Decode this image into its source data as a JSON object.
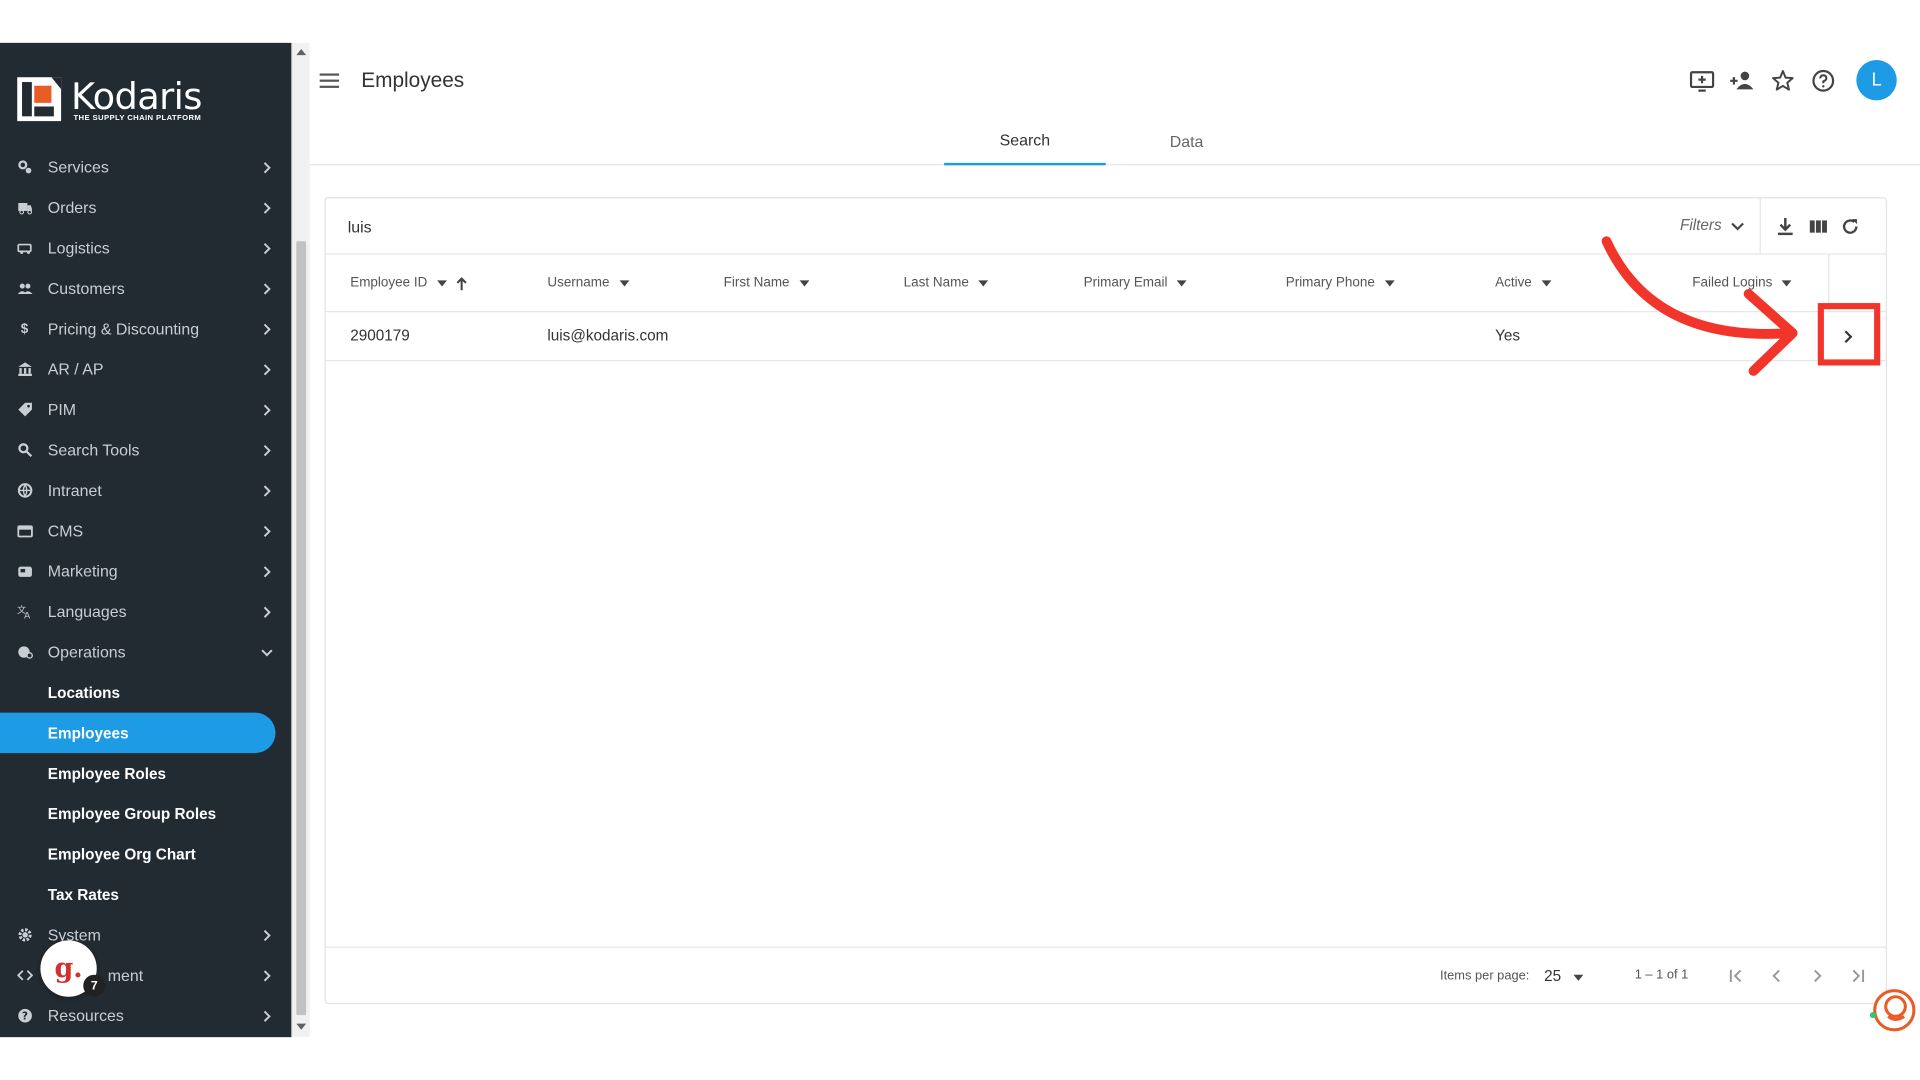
{
  "brand": {
    "name": "Kodaris",
    "tagline": "THE SUPPLY CHAIN PLATFORM"
  },
  "sidebar": {
    "items": [
      {
        "label": "Services",
        "icon": "services-icon"
      },
      {
        "label": "Orders",
        "icon": "truck-icon"
      },
      {
        "label": "Logistics",
        "icon": "logistics-icon"
      },
      {
        "label": "Customers",
        "icon": "people-icon"
      },
      {
        "label": "Pricing & Discounting",
        "icon": "dollar-icon"
      },
      {
        "label": "AR / AP",
        "icon": "bank-icon"
      },
      {
        "label": "PIM",
        "icon": "tag-icon"
      },
      {
        "label": "Search Tools",
        "icon": "search-icon"
      },
      {
        "label": "Intranet",
        "icon": "intranet-icon"
      },
      {
        "label": "CMS",
        "icon": "cms-icon"
      },
      {
        "label": "Marketing",
        "icon": "marketing-icon"
      },
      {
        "label": "Languages",
        "icon": "translate-icon"
      },
      {
        "label": "Operations",
        "icon": "operations-icon",
        "expanded": true
      }
    ],
    "operations_children": [
      {
        "label": "Locations"
      },
      {
        "label": "Employees",
        "active": true
      },
      {
        "label": "Employee Roles"
      },
      {
        "label": "Employee Group Roles"
      },
      {
        "label": "Employee Org Chart"
      },
      {
        "label": "Tax Rates"
      }
    ],
    "bottom_items": [
      {
        "label": "System",
        "icon": "gear-icon"
      },
      {
        "label": "Development",
        "icon": "code-icon"
      },
      {
        "label": "Resources",
        "icon": "help-icon"
      }
    ],
    "bottom_visible": [
      "System",
      "ment",
      "Resources"
    ]
  },
  "header": {
    "title": "Employees",
    "avatar_initial": "L",
    "tabs": [
      {
        "label": "Search",
        "active": true
      },
      {
        "label": "Data",
        "active": false
      }
    ],
    "icons": [
      "screen-add-icon",
      "person-add-icon",
      "star-icon",
      "help-icon"
    ]
  },
  "search": {
    "value": "luis",
    "filters_label": "Filters"
  },
  "table": {
    "columns": [
      "Employee ID",
      "Username",
      "First Name",
      "Last Name",
      "Primary Email",
      "Primary Phone",
      "Active",
      "Failed Logins"
    ],
    "rows": [
      {
        "employee_id": "2900179",
        "username": "luis@kodaris.com",
        "first_name": "",
        "last_name": "",
        "primary_email": "",
        "primary_phone": "",
        "active": "Yes",
        "failed_logins": ""
      }
    ]
  },
  "pagination": {
    "items_per_page_label": "Items per page:",
    "items_per_page": "25",
    "range": "1 – 1 of 1"
  },
  "badge": {
    "letter": "g.",
    "count": "7"
  },
  "colors": {
    "sidebar_bg": "#222a32",
    "accent": "#1e9be5",
    "logo_orange": "#e85c26",
    "annotation_red": "#f2352a"
  }
}
